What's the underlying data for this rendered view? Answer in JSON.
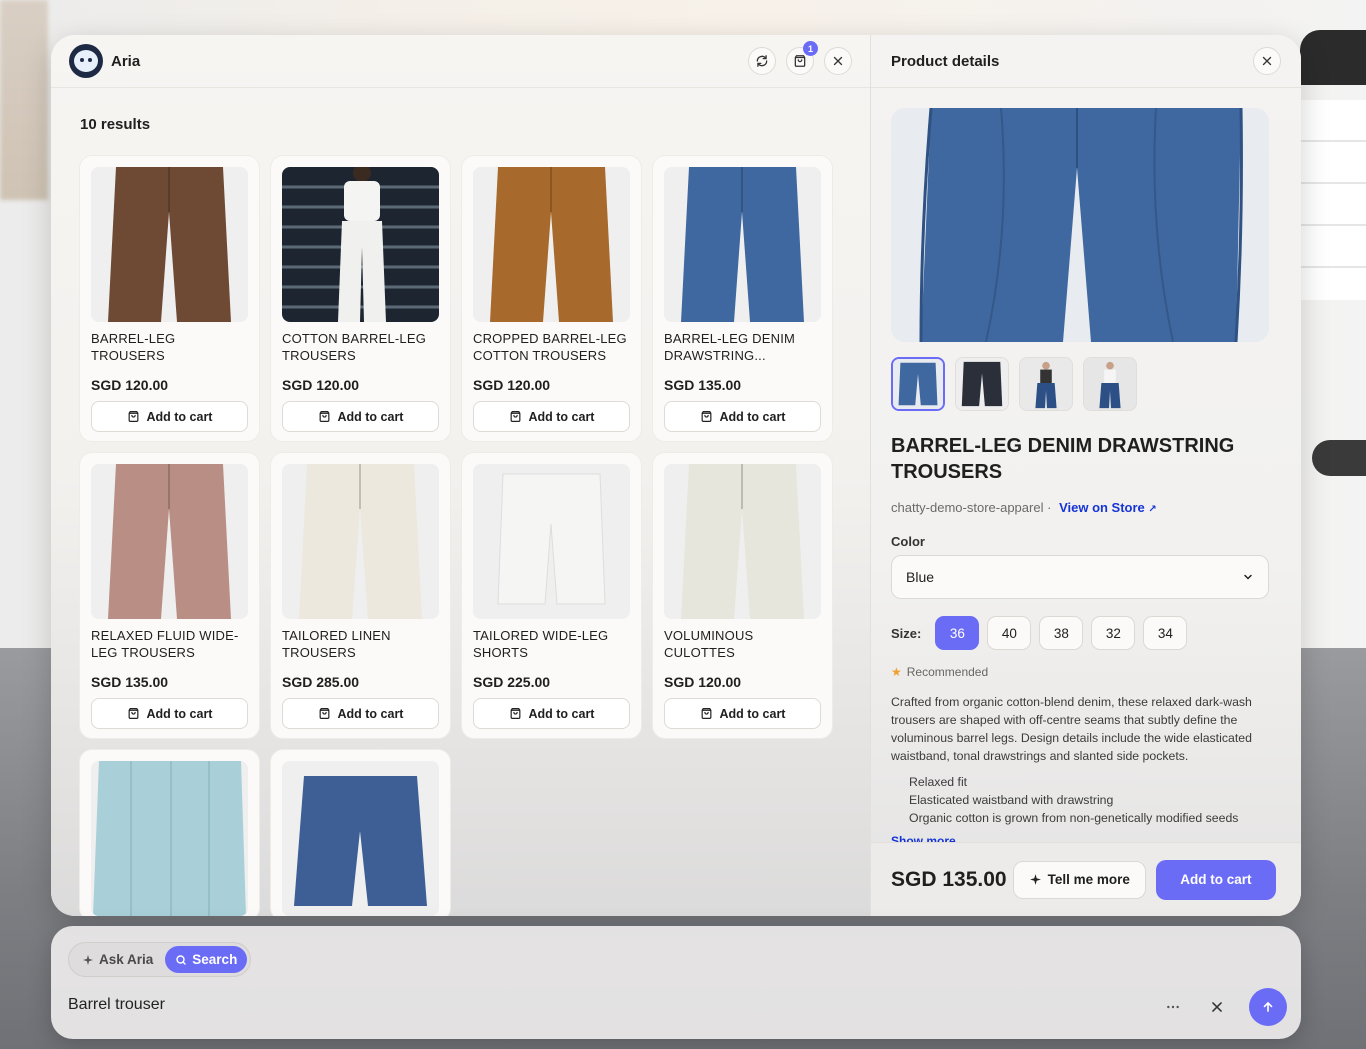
{
  "app": {
    "name": "Aria",
    "cart_count": "1"
  },
  "results": {
    "count_label": "10 results",
    "add_label": "Add to cart",
    "items": [
      {
        "name": "BARREL-LEG TROUSERS",
        "price": "SGD 120.00",
        "color": "#6e4a34"
      },
      {
        "name": "COTTON BARREL-LEG TROUSERS",
        "price": "SGD 120.00",
        "color": "#f2f2f0"
      },
      {
        "name": "CROPPED BARREL-LEG COTTON TROUSERS",
        "price": "SGD 120.00",
        "color": "#a86a2c"
      },
      {
        "name": "BARREL-LEG DENIM DRAWSTRING...",
        "price": "SGD 135.00",
        "color": "#3f68a0"
      },
      {
        "name": "RELAXED FLUID WIDE-LEG TROUSERS",
        "price": "SGD 135.00",
        "color": "#b98f85"
      },
      {
        "name": "TAILORED LINEN TROUSERS",
        "price": "SGD 285.00",
        "color": "#ece8dd"
      },
      {
        "name": "TAILORED WIDE-LEG SHORTS",
        "price": "SGD 225.00",
        "color": "#f5f5f4"
      },
      {
        "name": "VOLUMINOUS CULOTTES",
        "price": "SGD 120.00",
        "color": "#e6e6dc"
      },
      {
        "name": "",
        "price": "",
        "color": "#a9cfd8"
      },
      {
        "name": "",
        "price": "",
        "color": "#3d5f95"
      }
    ]
  },
  "detail": {
    "header": "Product details",
    "title": "BARREL-LEG DENIM DRAWSTRING TROUSERS",
    "store": "chatty-demo-store-apparel",
    "store_sep": "·",
    "view_store": "View on Store",
    "color_label": "Color",
    "color_value": "Blue",
    "size_label": "Size:",
    "sizes": [
      "36",
      "40",
      "38",
      "32",
      "34"
    ],
    "selected_size": "36",
    "recommended": "Recommended",
    "description": "Crafted from organic cotton-blend denim, these relaxed dark-wash trousers are shaped with off-centre seams that subtly define the voluminous barrel legs. Design details include the wide elasticated waistband, tonal drawstrings and slanted side pockets.",
    "bullets": [
      "Relaxed fit",
      "Elasticated waistband with drawstring",
      "Organic cotton is grown from non-genetically modified seeds"
    ],
    "show_more": "Show more",
    "price": "SGD 135.00",
    "tell_more": "Tell me more",
    "add_to_cart": "Add to cart"
  },
  "input": {
    "modes": [
      "Ask Aria",
      "Search"
    ],
    "active_mode": "Search",
    "query": "Barrel trouser"
  },
  "colors": {
    "accent": "#6b6cf6",
    "link": "#1534d6",
    "star": "#f0a030",
    "denim": "#3f68a0"
  }
}
